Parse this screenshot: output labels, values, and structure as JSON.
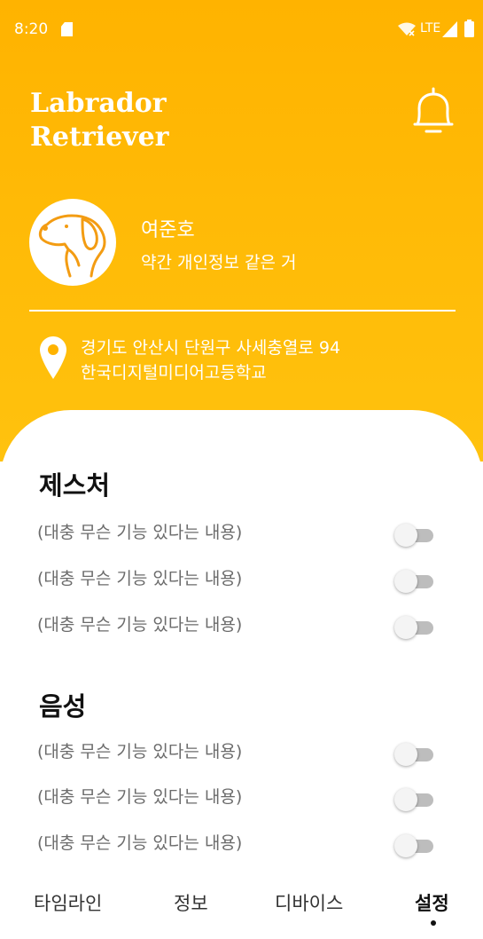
{
  "status_bar": {
    "time": "8:20",
    "network": "LTE",
    "icons": [
      "sd-card-icon",
      "wifi-icon",
      "signal-icon",
      "battery-icon"
    ]
  },
  "header": {
    "title": "Labrador Retriever",
    "owner_name": "여준호",
    "owner_desc": "약간 개인정보 같은 거",
    "address_line1": "경기도 안산시 단원구 사세충열로 94",
    "address_line2": "한국디지털미디어고등학교",
    "icons": [
      "bell-icon",
      "dog-avatar-icon",
      "location-pin-icon"
    ]
  },
  "sections": [
    {
      "title": "제스처",
      "options": [
        {
          "label": "(대충 무슨 기능 있다는 내용)",
          "enabled": false
        },
        {
          "label": "(대충 무슨 기능 있다는 내용)",
          "enabled": false
        },
        {
          "label": "(대충 무슨 기능 있다는 내용)",
          "enabled": false
        }
      ]
    },
    {
      "title": "음성",
      "options": [
        {
          "label": "(대충 무슨 기능 있다는 내용)",
          "enabled": false
        },
        {
          "label": "(대충 무슨 기능 있다는 내용)",
          "enabled": false
        },
        {
          "label": "(대충 무슨 기능 있다는 내용)",
          "enabled": false
        }
      ]
    }
  ],
  "nav": {
    "items": [
      "타임라인",
      "정보",
      "디바이스",
      "설정"
    ],
    "active": "설정"
  },
  "colors": {
    "accent": "#FFB300",
    "accent_light": "#FFC20E",
    "toggle_off": "#BDBDBD"
  }
}
